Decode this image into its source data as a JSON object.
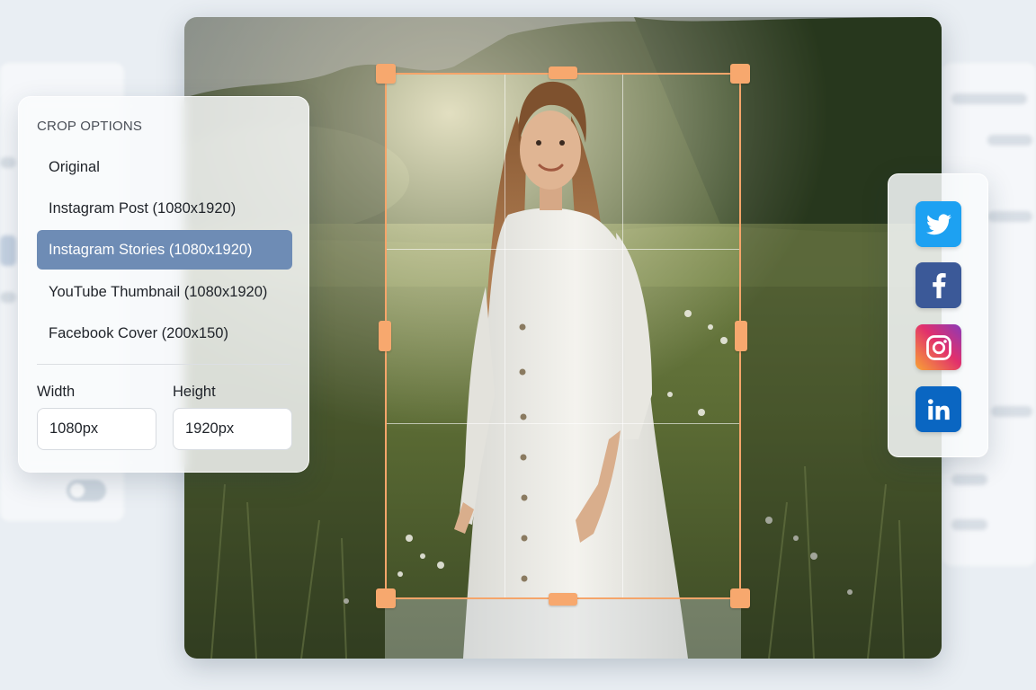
{
  "crop_panel": {
    "title": "CROP OPTIONS",
    "options": [
      {
        "label": "Original",
        "selected": false
      },
      {
        "label": "Instagram Post (1080x1920)",
        "selected": false
      },
      {
        "label": "Instagram Stories (1080x1920)",
        "selected": true
      },
      {
        "label": "YouTube Thumbnail (1080x1920)",
        "selected": false
      },
      {
        "label": "Facebook Cover (200x150)",
        "selected": false
      }
    ],
    "width_label": "Width",
    "height_label": "Height",
    "width_value": "1080px",
    "height_value": "1920px"
  },
  "social": [
    {
      "name": "twitter",
      "icon": "twitter-bird-icon",
      "color": "#1da1f2"
    },
    {
      "name": "facebook",
      "icon": "facebook-f-icon",
      "color": "#3b5998"
    },
    {
      "name": "instagram",
      "icon": "instagram-camera-icon",
      "color": "#e1306c"
    },
    {
      "name": "linkedin",
      "icon": "linkedin-in-icon",
      "color": "#0a66c2"
    }
  ],
  "colors": {
    "accent_crop": "#f5a56a",
    "selected_option": "#6e8cb5"
  }
}
